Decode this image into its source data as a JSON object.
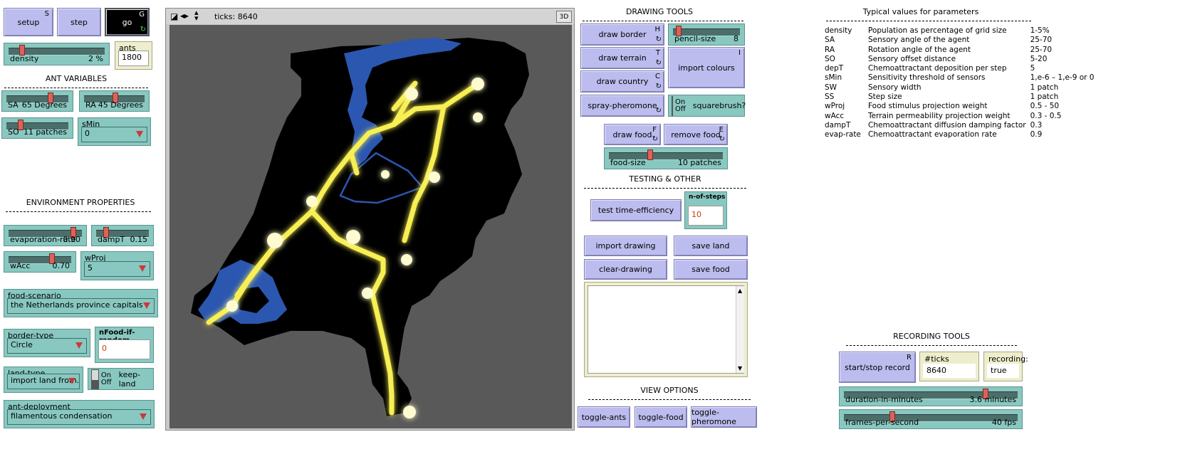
{
  "buttons": {
    "setup": {
      "label": "setup",
      "key": "S"
    },
    "step": {
      "label": "step"
    },
    "go": {
      "label": "go",
      "key": "G"
    }
  },
  "density": {
    "label": "density",
    "value": "2 %",
    "fraction": 0.12
  },
  "ants": {
    "label": "ants",
    "value": "1800"
  },
  "ant_vars": {
    "title": "ANT VARIABLES",
    "SA": {
      "label": "SA",
      "value": "65 Degrees",
      "fraction": 0.72
    },
    "RA": {
      "label": "RA",
      "value": "45 Degrees",
      "fraction": 0.5
    },
    "SO": {
      "label": "SO",
      "value": "11 patches",
      "fraction": 0.2
    },
    "sMin": {
      "label": "sMin",
      "value": "0"
    }
  },
  "env": {
    "title": "ENVIRONMENT PROPERTIES",
    "evaporation_rate": {
      "label": "evaporation-rate",
      "value": "0.90",
      "fraction": 0.9
    },
    "dampT": {
      "label": "dampT",
      "value": "0.15",
      "fraction": 0.15
    },
    "wAcc": {
      "label": "wAcc",
      "value": "0.70",
      "fraction": 0.7
    },
    "wProj": {
      "label": "wProj",
      "value": "5"
    },
    "food_scenario": {
      "label": "food-scenario",
      "value": "the Netherlands province capitals"
    },
    "border_type": {
      "label": "border-type",
      "value": "Circle"
    },
    "nFood_if_random": {
      "label": "nFood-if-random",
      "value": "0"
    },
    "land_type": {
      "label": "land-type",
      "value": "import land from..."
    },
    "keep_land": {
      "label": "keep-land",
      "on": "On",
      "off": "Off"
    },
    "ant_deployment": {
      "label": "ant-deployment",
      "value": "filamentous condensation"
    }
  },
  "view": {
    "ticks_label": "ticks: 8640",
    "three_d": "3D"
  },
  "drawing_tools": {
    "title": "DRAWING TOOLS",
    "draw_border": {
      "label": "draw border",
      "key": "H"
    },
    "draw_terrain": {
      "label": "draw terrain",
      "key": "T"
    },
    "draw_country": {
      "label": "draw country",
      "key": "C"
    },
    "spray_pheromone": {
      "label": "spray-pheromone"
    },
    "pencil_size": {
      "label": "pencil-size",
      "value": "8",
      "fraction": 0.05
    },
    "import_colours": {
      "label": "import colours",
      "key": "I"
    },
    "squarebrush": {
      "label": "squarebrush?",
      "on": "On",
      "off": "Off"
    },
    "draw_food": {
      "label": "draw food",
      "key": "F"
    },
    "remove_food": {
      "label": "remove food",
      "key": "E"
    },
    "food_size": {
      "label": "food-size",
      "value": "10 patches",
      "fraction": 0.35
    }
  },
  "testing": {
    "title": "TESTING & OTHER",
    "test_time": {
      "label": "test time-efficiency"
    },
    "n_of_steps": {
      "label": "n-of-steps",
      "value": "10"
    },
    "import_drawing": {
      "label": "import drawing"
    },
    "save_land": {
      "label": "save land"
    },
    "clear_drawing": {
      "label": "clear-drawing"
    },
    "save_food": {
      "label": "save food"
    }
  },
  "view_options": {
    "title": "VIEW OPTIONS",
    "toggle_ants": "toggle-ants",
    "toggle_food": "toggle-food",
    "toggle_pheromone": "toggle-pheromone"
  },
  "params": {
    "title": "Typical values for parameters",
    "rows": [
      [
        "density",
        "Population as percentage of grid size",
        "1-5%"
      ],
      [
        "SA",
        "Sensory angle of the agent",
        "25-70"
      ],
      [
        "RA",
        "Rotation angle of the agent",
        "25-70"
      ],
      [
        "SO",
        "Sensory offset distance",
        "5-20"
      ],
      [
        "depT",
        "Chemoattractant deposition per step",
        "5"
      ],
      [
        "sMin",
        "Sensitivity threshold of sensors",
        "1,e-6 – 1,e-9 or 0"
      ],
      [
        "SW",
        "Sensory width",
        "1 patch"
      ],
      [
        "SS",
        "Step size",
        "1 patch"
      ],
      [
        "wProj",
        "Food stimulus projection weight",
        "0.5 - 50"
      ],
      [
        "wAcc",
        "Terrain permeability projection weight",
        "0.3 - 0.5"
      ],
      [
        "dampT",
        "Chemoattractant diffusion damping factor",
        "0.3"
      ],
      [
        "evap-rate",
        "Chemoattractant evaporation rate",
        "0.9"
      ]
    ]
  },
  "recording": {
    "title": "RECORDING TOOLS",
    "start_stop": {
      "label": "start/stop record",
      "key": "R"
    },
    "ticks_recording": {
      "label": "#ticks recording:",
      "value": "8640"
    },
    "recording_flag": {
      "label": "recording:",
      "value": "true"
    },
    "duration": {
      "label": "duration-in-minutes",
      "value": "3.6 minutes",
      "fraction": 0.82
    },
    "fps": {
      "label": "frames-per-second",
      "value": "40 fps",
      "fraction": 0.27
    }
  }
}
